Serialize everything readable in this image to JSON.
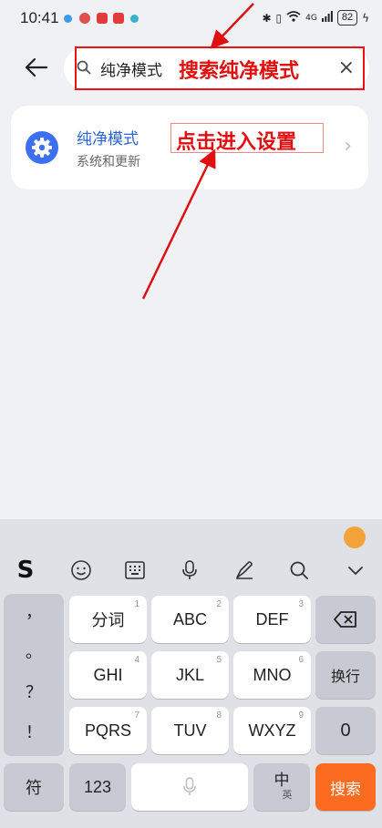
{
  "status_bar": {
    "time": "10:41",
    "battery": "82",
    "network": "4G"
  },
  "search": {
    "query": "纯净模式",
    "clear_label": "×"
  },
  "result": {
    "title": "纯净模式",
    "subtitle": "系统和更新",
    "chevron": "›"
  },
  "annotations": {
    "search_hint": "搜索纯净模式",
    "tap_hint": "点击进入设置"
  },
  "keyboard": {
    "left_column": [
      "，",
      "。",
      "？",
      "！"
    ],
    "rows": [
      [
        {
          "label": "分词",
          "num": "1"
        },
        {
          "label": "ABC",
          "num": "2"
        },
        {
          "label": "DEF",
          "num": "3"
        }
      ],
      [
        {
          "label": "GHI",
          "num": "4"
        },
        {
          "label": "JKL",
          "num": "5"
        },
        {
          "label": "MNO",
          "num": "6"
        }
      ],
      [
        {
          "label": "PQRS",
          "num": "7"
        },
        {
          "label": "TUV",
          "num": "8"
        },
        {
          "label": "WXYZ",
          "num": "9"
        }
      ]
    ],
    "newline": "换行",
    "zero": "0",
    "symbols": "符",
    "num123": "123",
    "lang_main": "中",
    "lang_sub": "英",
    "search_key": "搜索"
  },
  "colors": {
    "accent": "#3d6ff2",
    "annotation": "#e01010",
    "search_key": "#fc6b1f"
  }
}
